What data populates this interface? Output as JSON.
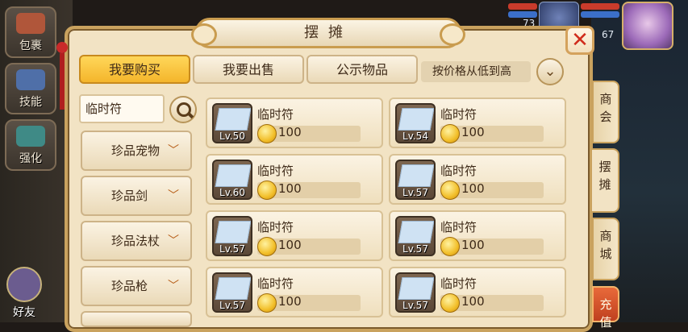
{
  "background_hud": {
    "left_buttons": [
      {
        "label": "包裹",
        "icon": "bag-icon"
      },
      {
        "label": "技能",
        "icon": "skill-book-icon"
      },
      {
        "label": "强化",
        "icon": "hammer-icon"
      }
    ],
    "friends_label": "好友",
    "top_numbers": {
      "left": "73",
      "right": "67"
    }
  },
  "panel": {
    "title": "摆摊",
    "close_icon": "close-icon",
    "tabs": [
      {
        "label": "我要购买",
        "active": true
      },
      {
        "label": "我要出售",
        "active": false
      },
      {
        "label": "公示物品",
        "active": false
      }
    ],
    "sort": {
      "label": "按价格从低到高"
    },
    "search": {
      "value": "临时符"
    },
    "categories": [
      "珍品宠物",
      "珍品剑",
      "珍品法杖",
      "珍品枪"
    ],
    "items": [
      {
        "name": "临时符",
        "level": "Lv.50",
        "price": "100"
      },
      {
        "name": "临时符",
        "level": "Lv.54",
        "price": "100"
      },
      {
        "name": "临时符",
        "level": "Lv.60",
        "price": "100"
      },
      {
        "name": "临时符",
        "level": "Lv.57",
        "price": "100"
      },
      {
        "name": "临时符",
        "level": "Lv.57",
        "price": "100"
      },
      {
        "name": "临时符",
        "level": "Lv.57",
        "price": "100"
      },
      {
        "name": "临时符",
        "level": "Lv.57",
        "price": "100"
      },
      {
        "name": "临时符",
        "level": "Lv.57",
        "price": "100"
      }
    ]
  },
  "side_tabs": [
    {
      "label": "商会",
      "state": "inactive"
    },
    {
      "label": "摆摊",
      "state": "active"
    },
    {
      "label": "商城",
      "state": "inactive"
    },
    {
      "label": "充值",
      "state": "recharge"
    }
  ],
  "colors": {
    "accent_gold": "#f4b52b",
    "close_red": "#d02b1b",
    "panel_bg": "#f2e3c4"
  }
}
